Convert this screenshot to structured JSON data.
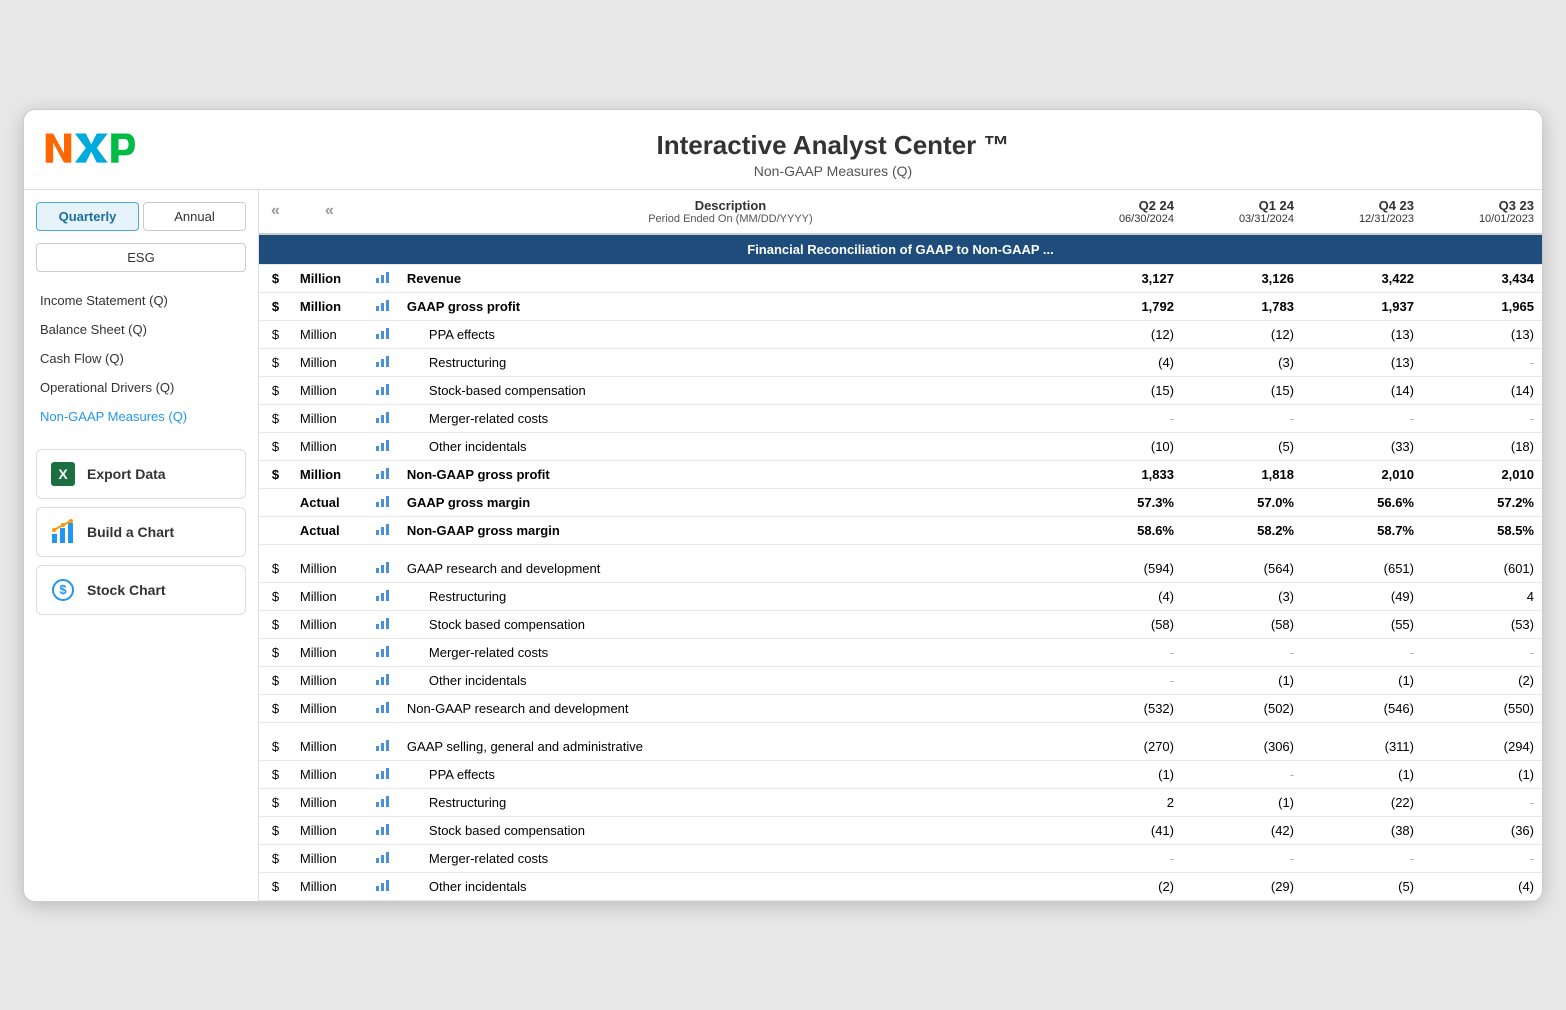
{
  "app": {
    "title": "Interactive Analyst Center ™",
    "subtitle": "Non-GAAP Measures (Q)"
  },
  "sidebar": {
    "tabs": [
      {
        "label": "Quarterly",
        "active": true
      },
      {
        "label": "Annual",
        "active": false
      }
    ],
    "esg_label": "ESG",
    "nav_items": [
      {
        "label": "Income Statement (Q)",
        "active": false
      },
      {
        "label": "Balance Sheet (Q)",
        "active": false
      },
      {
        "label": "Cash Flow (Q)",
        "active": false
      },
      {
        "label": "Operational Drivers (Q)",
        "active": false
      },
      {
        "label": "Non-GAAP Measures (Q)",
        "active": true
      }
    ],
    "actions": [
      {
        "label": "Export Data",
        "icon": "excel-icon"
      },
      {
        "label": "Build a Chart",
        "icon": "chart-icon"
      },
      {
        "label": "Stock Chart",
        "icon": "stock-icon"
      }
    ]
  },
  "table": {
    "col_headers": {
      "currency": "",
      "unit": "",
      "chart": "",
      "description": "Description",
      "description_sub": "Period Ended On (MM/DD/YYYY)",
      "q2_24": "Q2 24",
      "q2_24_date": "06/30/2024",
      "q1_24": "Q1 24",
      "q1_24_date": "03/31/2024",
      "q4_23": "Q4 23",
      "q4_23_date": "12/31/2023",
      "q3_23": "Q3 23",
      "q3_23_date": "10/01/2023"
    },
    "section_header": "Financial Reconciliation of GAAP to Non-GAAP ...",
    "rows": [
      {
        "currency": "$",
        "unit": "Million",
        "bold": true,
        "indent": false,
        "description": "Revenue",
        "q2_24": "3,127",
        "q1_24": "3,126",
        "q4_23": "3,422",
        "q3_23": "3,434"
      },
      {
        "currency": "$",
        "unit": "Million",
        "bold": true,
        "indent": false,
        "description": "GAAP gross profit",
        "q2_24": "1,792",
        "q1_24": "1,783",
        "q4_23": "1,937",
        "q3_23": "1,965"
      },
      {
        "currency": "$",
        "unit": "Million",
        "bold": false,
        "indent": true,
        "description": "PPA effects",
        "q2_24": "(12)",
        "q1_24": "(12)",
        "q4_23": "(13)",
        "q3_23": "(13)"
      },
      {
        "currency": "$",
        "unit": "Million",
        "bold": false,
        "indent": true,
        "description": "Restructuring",
        "q2_24": "(4)",
        "q1_24": "(3)",
        "q4_23": "(13)",
        "q3_23": "-"
      },
      {
        "currency": "$",
        "unit": "Million",
        "bold": false,
        "indent": true,
        "description": "Stock-based compensation",
        "q2_24": "(15)",
        "q1_24": "(15)",
        "q4_23": "(14)",
        "q3_23": "(14)"
      },
      {
        "currency": "$",
        "unit": "Million",
        "bold": false,
        "indent": true,
        "description": "Merger-related costs",
        "q2_24": "-",
        "q1_24": "-",
        "q4_23": "-",
        "q3_23": "-"
      },
      {
        "currency": "$",
        "unit": "Million",
        "bold": false,
        "indent": true,
        "description": "Other incidentals",
        "q2_24": "(10)",
        "q1_24": "(5)",
        "q4_23": "(33)",
        "q3_23": "(18)"
      },
      {
        "currency": "$",
        "unit": "Million",
        "bold": true,
        "indent": false,
        "description": "Non-GAAP gross profit",
        "q2_24": "1,833",
        "q1_24": "1,818",
        "q4_23": "2,010",
        "q3_23": "2,010"
      },
      {
        "currency": "",
        "unit": "Actual",
        "bold": true,
        "indent": false,
        "description": "GAAP gross margin",
        "q2_24": "57.3%",
        "q1_24": "57.0%",
        "q4_23": "56.6%",
        "q3_23": "57.2%"
      },
      {
        "currency": "",
        "unit": "Actual",
        "bold": true,
        "indent": false,
        "description": "Non-GAAP gross margin",
        "q2_24": "58.6%",
        "q1_24": "58.2%",
        "q4_23": "58.7%",
        "q3_23": "58.5%"
      },
      {
        "currency": "$",
        "unit": "Million",
        "bold": false,
        "indent": false,
        "description": "GAAP research and development",
        "q2_24": "(594)",
        "q1_24": "(564)",
        "q4_23": "(651)",
        "q3_23": "(601)",
        "spacer_before": true
      },
      {
        "currency": "$",
        "unit": "Million",
        "bold": false,
        "indent": true,
        "description": "Restructuring",
        "q2_24": "(4)",
        "q1_24": "(3)",
        "q4_23": "(49)",
        "q3_23": "4"
      },
      {
        "currency": "$",
        "unit": "Million",
        "bold": false,
        "indent": true,
        "description": "Stock based compensation",
        "q2_24": "(58)",
        "q1_24": "(58)",
        "q4_23": "(55)",
        "q3_23": "(53)"
      },
      {
        "currency": "$",
        "unit": "Million",
        "bold": false,
        "indent": true,
        "description": "Merger-related costs",
        "q2_24": "-",
        "q1_24": "-",
        "q4_23": "-",
        "q3_23": "-"
      },
      {
        "currency": "$",
        "unit": "Million",
        "bold": false,
        "indent": true,
        "description": "Other incidentals",
        "q2_24": "-",
        "q1_24": "(1)",
        "q4_23": "(1)",
        "q3_23": "(2)"
      },
      {
        "currency": "$",
        "unit": "Million",
        "bold": false,
        "indent": false,
        "description": "Non-GAAP research and development",
        "q2_24": "(532)",
        "q1_24": "(502)",
        "q4_23": "(546)",
        "q3_23": "(550)"
      },
      {
        "currency": "$",
        "unit": "Million",
        "bold": false,
        "indent": false,
        "description": "GAAP selling, general and administrative",
        "q2_24": "(270)",
        "q1_24": "(306)",
        "q4_23": "(311)",
        "q3_23": "(294)",
        "spacer_before": true
      },
      {
        "currency": "$",
        "unit": "Million",
        "bold": false,
        "indent": true,
        "description": "PPA effects",
        "q2_24": "(1)",
        "q1_24": "-",
        "q4_23": "(1)",
        "q3_23": "(1)"
      },
      {
        "currency": "$",
        "unit": "Million",
        "bold": false,
        "indent": true,
        "description": "Restructuring",
        "q2_24": "2",
        "q1_24": "(1)",
        "q4_23": "(22)",
        "q3_23": "-"
      },
      {
        "currency": "$",
        "unit": "Million",
        "bold": false,
        "indent": true,
        "description": "Stock based compensation",
        "q2_24": "(41)",
        "q1_24": "(42)",
        "q4_23": "(38)",
        "q3_23": "(36)"
      },
      {
        "currency": "$",
        "unit": "Million",
        "bold": false,
        "indent": true,
        "description": "Merger-related costs",
        "q2_24": "-",
        "q1_24": "-",
        "q4_23": "-",
        "q3_23": "-"
      },
      {
        "currency": "$",
        "unit": "Million",
        "bold": false,
        "indent": true,
        "description": "Other incidentals",
        "q2_24": "(2)",
        "q1_24": "(29)",
        "q4_23": "(5)",
        "q3_23": "(4)"
      }
    ]
  }
}
